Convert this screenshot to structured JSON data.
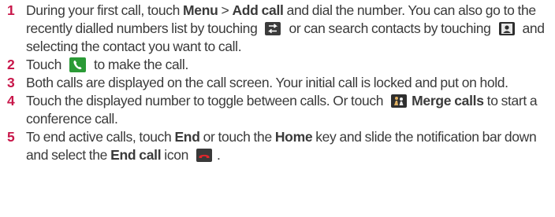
{
  "steps": [
    {
      "number": "1",
      "text_a": "During your first call, touch ",
      "bold_a": "Menu",
      "text_b": " > ",
      "bold_b": "Add call",
      "text_c": " and dial the number. You can also go to the recently dialled numbers list by touching ",
      "icon_a": "recent-calls-icon",
      "text_d": " or can search contacts by touching ",
      "icon_b": "contacts-icon",
      "text_e": " and selecting the contact you want to call."
    },
    {
      "number": "2",
      "text_a": "Touch ",
      "icon_a": "call-icon",
      "text_b": " to make the call."
    },
    {
      "number": "3",
      "text_a": "Both calls are displayed on the call screen. Your initial call is locked and put on hold."
    },
    {
      "number": "4",
      "text_a": "Touch the displayed number to toggle between calls. Or touch ",
      "icon_a": "merge-calls-icon",
      "bold_a": "Merge calls",
      "text_b": " to start a conference call."
    },
    {
      "number": "5",
      "text_a": "To end active calls, touch ",
      "bold_a": "End",
      "text_b": " or touch the ",
      "bold_b": "Home",
      "text_c": " key and slide the notification bar down and select the ",
      "bold_c": "End call",
      "text_d": " icon ",
      "icon_a": "end-call-icon",
      "text_e": "."
    }
  ],
  "colors": {
    "accent": "#c8174a",
    "text": "#3a3a3a",
    "call_green": "#2a9a36",
    "end_red": "#e0262b"
  }
}
